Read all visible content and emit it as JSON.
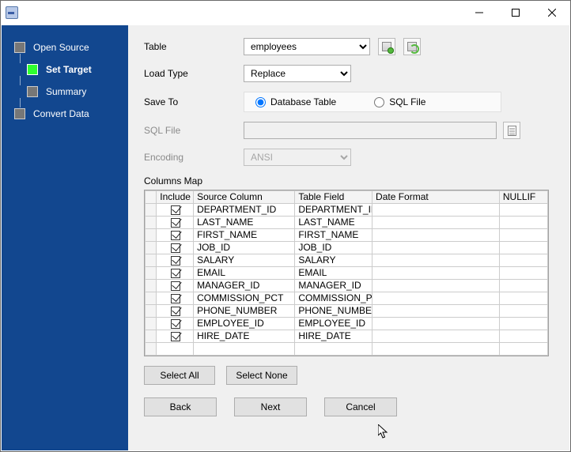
{
  "sidebar": {
    "steps": [
      {
        "label": "Open Source",
        "active": false
      },
      {
        "label": "Set Target",
        "active": true
      },
      {
        "label": "Summary",
        "active": false
      },
      {
        "label": "Convert Data",
        "active": false
      }
    ]
  },
  "form": {
    "table_label": "Table",
    "table_value": "employees",
    "loadtype_label": "Load Type",
    "loadtype_value": "Replace",
    "saveto_label": "Save To",
    "saveto_db": "Database Table",
    "saveto_sql": "SQL File",
    "sqlfile_label": "SQL File",
    "sqlfile_value": "",
    "encoding_label": "Encoding",
    "encoding_value": "ANSI",
    "columns_label": "Columns Map",
    "headers": {
      "include": "Include",
      "source": "Source Column",
      "target": "Table Field",
      "date": "Date Format",
      "nullif": "NULLIF"
    },
    "rows": [
      {
        "src": "DEPARTMENT_ID",
        "tgt": "DEPARTMENT_ID"
      },
      {
        "src": "LAST_NAME",
        "tgt": "LAST_NAME"
      },
      {
        "src": "FIRST_NAME",
        "tgt": "FIRST_NAME"
      },
      {
        "src": "JOB_ID",
        "tgt": "JOB_ID"
      },
      {
        "src": "SALARY",
        "tgt": "SALARY"
      },
      {
        "src": "EMAIL",
        "tgt": "EMAIL"
      },
      {
        "src": "MANAGER_ID",
        "tgt": "MANAGER_ID"
      },
      {
        "src": "COMMISSION_PCT",
        "tgt": "COMMISSION_PC"
      },
      {
        "src": "PHONE_NUMBER",
        "tgt": "PHONE_NUMBER"
      },
      {
        "src": "EMPLOYEE_ID",
        "tgt": "EMPLOYEE_ID"
      },
      {
        "src": "HIRE_DATE",
        "tgt": "HIRE_DATE"
      }
    ]
  },
  "buttons": {
    "select_all": "Select All",
    "select_none": "Select None",
    "back": "Back",
    "next": "Next",
    "cancel": "Cancel"
  }
}
